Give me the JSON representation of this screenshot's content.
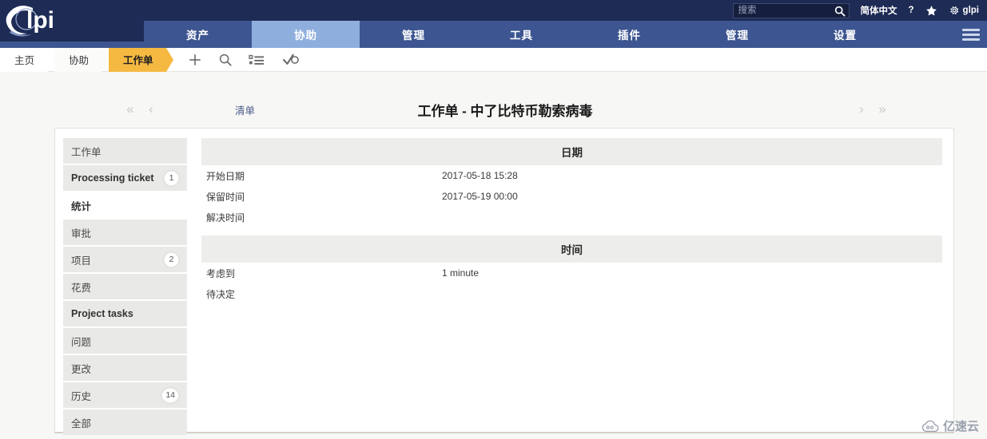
{
  "brand": {
    "name": "glpi",
    "logo_icon": "glpi-logo"
  },
  "topbar": {
    "search": {
      "placeholder": "搜索",
      "value": "",
      "icon": "search-icon"
    },
    "language": "简体中文",
    "help": "?",
    "favorite_icon": "star-icon",
    "settings_icon": "gear-icon",
    "user": "glpi",
    "menu_icon": "hamburger-icon"
  },
  "nav": {
    "items": [
      {
        "label": "资产",
        "active": false
      },
      {
        "label": "协助",
        "active": true
      },
      {
        "label": "管理",
        "active": false
      },
      {
        "label": "工具",
        "active": false
      },
      {
        "label": "插件",
        "active": false
      },
      {
        "label": "管理",
        "active": false
      },
      {
        "label": "设置",
        "active": false
      }
    ]
  },
  "breadcrumb": {
    "items": [
      {
        "label": "主页",
        "active": false
      },
      {
        "label": "协助",
        "active": false
      },
      {
        "label": "工作单",
        "active": true
      }
    ],
    "icons": [
      {
        "name": "plus-icon"
      },
      {
        "name": "search-icon"
      },
      {
        "name": "list-icon"
      },
      {
        "name": "validation-icon"
      }
    ]
  },
  "title_row": {
    "first_label": "«",
    "prev_label": "‹",
    "next_label": "›",
    "last_label": "»",
    "list_link": "清单",
    "title": "工作单 - 中了比特币勒索病毒"
  },
  "sidebar": {
    "items": [
      {
        "label": "工作单",
        "badge": "",
        "bold": false,
        "selected": false
      },
      {
        "label": "Processing ticket",
        "badge": "1",
        "bold": true,
        "selected": false
      },
      {
        "label": "统计",
        "badge": "",
        "bold": true,
        "selected": true
      },
      {
        "label": "审批",
        "badge": "",
        "bold": false,
        "selected": false
      },
      {
        "label": "项目",
        "badge": "2",
        "bold": false,
        "selected": false
      },
      {
        "label": "花费",
        "badge": "",
        "bold": false,
        "selected": false
      },
      {
        "label": "Project tasks",
        "badge": "",
        "bold": true,
        "selected": false
      },
      {
        "label": "问题",
        "badge": "",
        "bold": false,
        "selected": false
      },
      {
        "label": "更改",
        "badge": "",
        "bold": false,
        "selected": false
      },
      {
        "label": "历史",
        "badge": "14",
        "bold": false,
        "selected": false
      },
      {
        "label": "全部",
        "badge": "",
        "bold": false,
        "selected": false
      }
    ]
  },
  "main": {
    "sections": [
      {
        "heading": "日期",
        "rows": [
          {
            "key": "开始日期",
            "value": "2017-05-18 15:28"
          },
          {
            "key": "保留时间",
            "value": "2017-05-19 00:00"
          },
          {
            "key": "解决时间",
            "value": ""
          }
        ]
      },
      {
        "heading": "时间",
        "rows": [
          {
            "key": "考虑到",
            "value": "1 minute"
          },
          {
            "key": "待决定",
            "value": ""
          }
        ]
      }
    ]
  },
  "watermark": {
    "text": "亿速云",
    "icon": "cloud-icon"
  },
  "colors": {
    "topbar_bg": "#1d2b55",
    "nav_bg": "#3d5691",
    "nav_active_bg": "#8eafdd",
    "crumb_active_bg": "#f5b942",
    "panel_bg": "#ffffff",
    "section_head_bg": "#ededeb",
    "side_item_bg": "#e9e9e7"
  }
}
